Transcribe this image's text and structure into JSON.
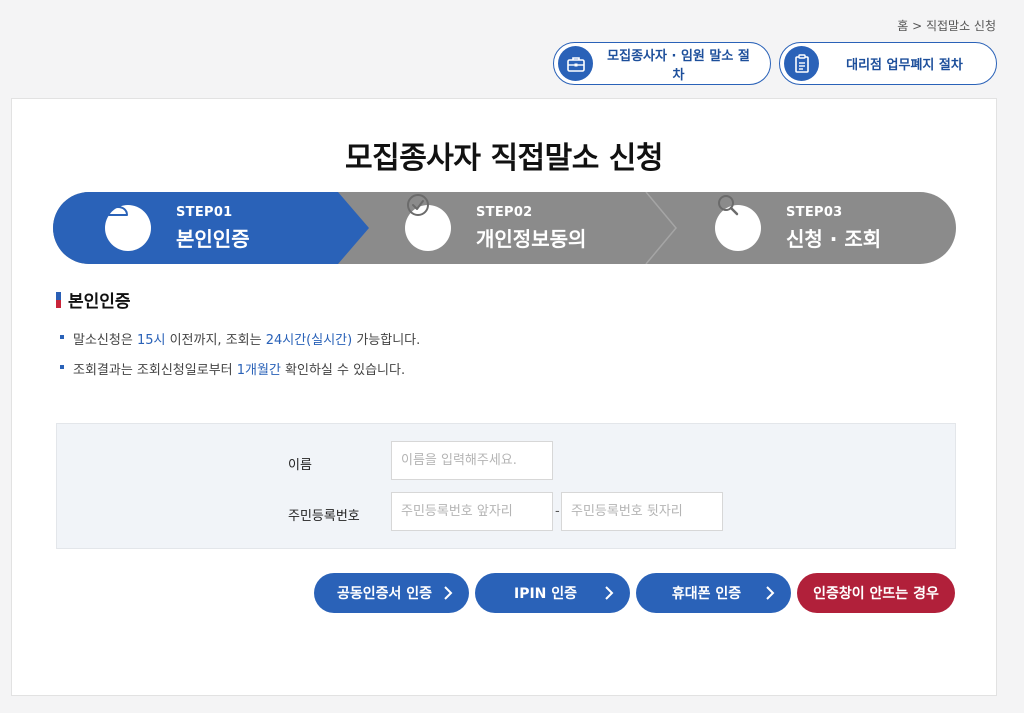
{
  "breadcrumb": "홈 > 직접말소 신청",
  "top_links": [
    {
      "label": "모집종사자 · 임원 말소 절차",
      "icon": "briefcase-icon"
    },
    {
      "label": "대리점 업무폐지 절차",
      "icon": "document-icon"
    }
  ],
  "page_title": "모집종사자 직접말소 신청",
  "steps": [
    {
      "num": "STEP01",
      "label": "본인인증",
      "icon": "person-icon",
      "active": true
    },
    {
      "num": "STEP02",
      "label": "개인정보동의",
      "icon": "check-circle-icon",
      "active": false
    },
    {
      "num": "STEP03",
      "label": "신청 · 조회",
      "icon": "search-icon",
      "active": false
    }
  ],
  "section_title": "본인인증",
  "notes": {
    "n1": {
      "a": "말소신청은 ",
      "b": "15시",
      "c": " 이전까지, 조회는 ",
      "d": "24시간(실시간)",
      "e": " 가능합니다."
    },
    "n2": {
      "a": "조회결과는 조회신청일로부터 ",
      "b": "1개월간",
      "c": " 확인하실 수 있습니다."
    }
  },
  "form": {
    "name_label": "이름",
    "name_placeholder": "이름을 입력해주세요.",
    "rrn_label": "주민등록번호",
    "rrn_front_placeholder": "주민등록번호 앞자리",
    "rrn_back_placeholder": "주민등록번호 뒷자리",
    "separator": "-"
  },
  "auth_buttons": [
    {
      "label": "공동인증서 인증"
    },
    {
      "label": "IPIN 인증"
    },
    {
      "label": "휴대폰 인증"
    },
    {
      "label": "인증창이 안뜨는 경우"
    }
  ],
  "colors": {
    "primary": "#2a62b8",
    "step_inactive": "#8b8b8b",
    "danger": "#b1203a"
  }
}
